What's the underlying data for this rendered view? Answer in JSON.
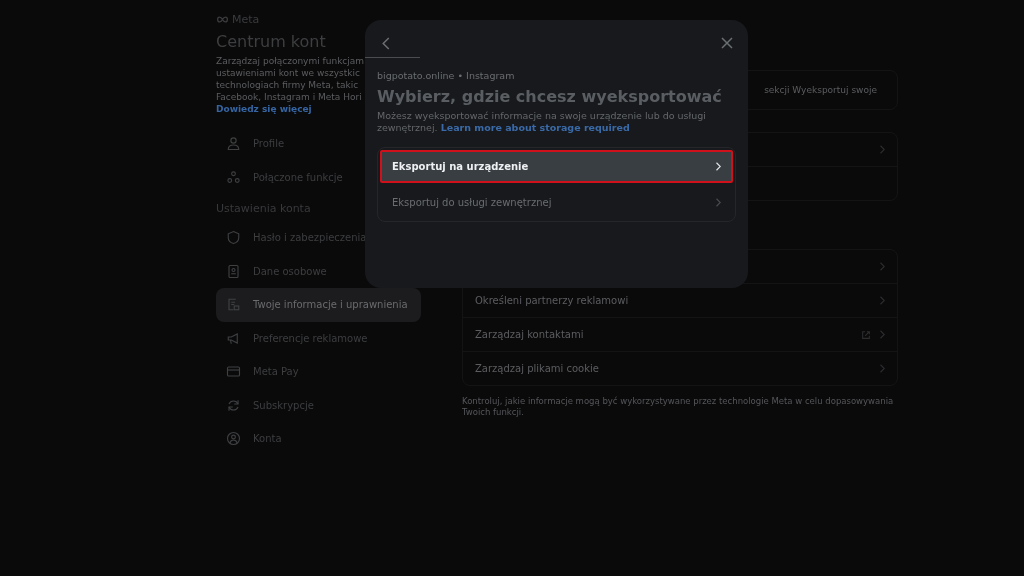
{
  "brand": "Meta",
  "sidebar": {
    "title": "Centrum kont",
    "description_lines": [
      "Zarządzaj połączonymi funkcjam",
      "ustawieniami kont we wszystkic",
      "technologiach firmy Meta, takic",
      "Facebook, Instagram i Meta Hori"
    ],
    "link": "Dowiedz się więcej",
    "top_items": [
      {
        "label": "Profile",
        "selected": false
      },
      {
        "label": "Połączone funkcje",
        "selected": false
      }
    ],
    "section_title": "Ustawienia konta",
    "items": [
      {
        "label": "Hasło i zabezpieczenia",
        "selected": false
      },
      {
        "label": "Dane osobowe",
        "selected": false
      },
      {
        "label": "Twoje informacje i uprawnienia",
        "selected": true
      },
      {
        "label": "Preferencje reklamowe",
        "selected": false
      },
      {
        "label": "Meta Pay",
        "selected": false
      },
      {
        "label": "Subskrypcje",
        "selected": false
      },
      {
        "label": "Konta",
        "selected": false
      }
    ]
  },
  "content": {
    "notice": "sekcji Wyeksportuj swoje",
    "rows": [
      {
        "label": "Określeni partnerzy reklamowi",
        "external": false
      },
      {
        "label": "Zarządzaj kontaktami",
        "external": true
      },
      {
        "label": "Zarządzaj plikami cookie",
        "external": false
      }
    ],
    "footer": "Kontroluj, jakie informacje mogą być wykorzystywane przez technologie Meta w celu dopasowywania Twoich funkcji."
  },
  "modal": {
    "account": "bigpotato.online • Instagram",
    "title": "Wybierz, gdzie chcesz wyeksportować",
    "description": "Możesz wyeksportować informacje na swoje urządzenie lub do usługi zewnętrznej.",
    "link": "Learn more about storage required",
    "options": [
      {
        "label": "Eksportuj na urządzenie",
        "selected": true
      },
      {
        "label": "Eksportuj do usługi zewnętrznej",
        "selected": false
      }
    ]
  }
}
